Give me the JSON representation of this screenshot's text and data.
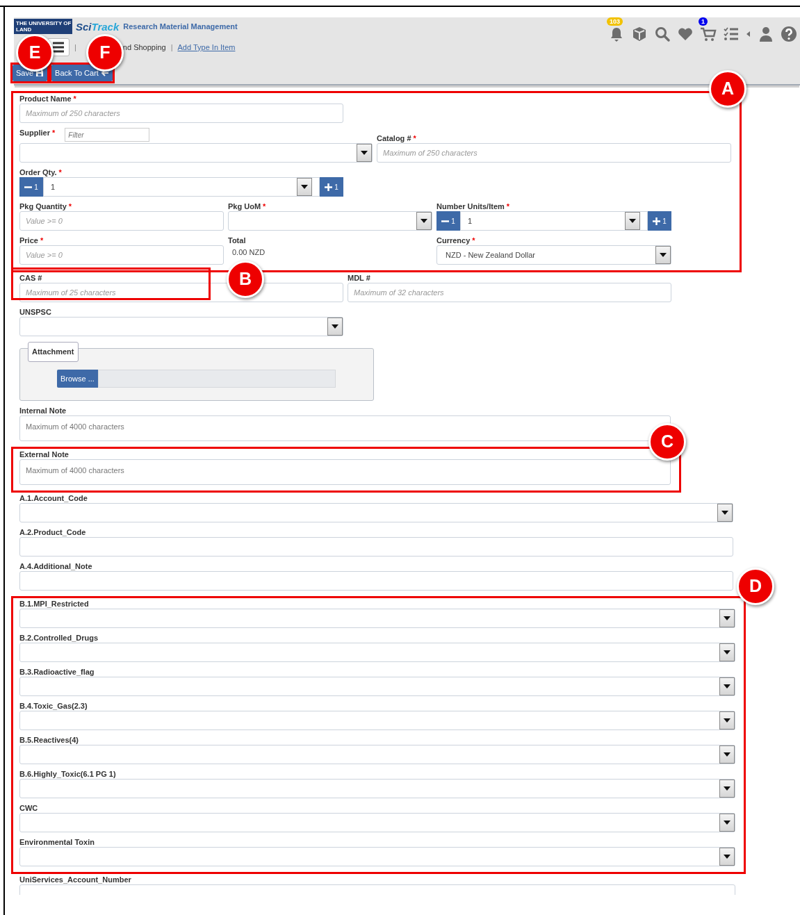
{
  "header": {
    "logo_lines": [
      "THE UNIVERSITY OF",
      "LAND"
    ],
    "app_name_parts": [
      "Sci",
      "Track"
    ],
    "app_subtitle": "Research Material Management",
    "breadcrumb": {
      "separator": "|",
      "items": [
        {
          "label": "nd Shopping",
          "link": false
        },
        {
          "label": "Add Type In Item",
          "link": true
        }
      ]
    },
    "toolbar_icons": [
      {
        "kind": "bell",
        "badge": "103",
        "color": "#f2c200"
      },
      {
        "kind": "box"
      },
      {
        "kind": "search"
      },
      {
        "kind": "heart"
      },
      {
        "kind": "cart",
        "badge": "1",
        "color": "#0000ee"
      },
      {
        "kind": "checklist"
      },
      {
        "kind": "caret"
      },
      {
        "kind": "user"
      },
      {
        "kind": "help"
      }
    ],
    "actions": [
      {
        "label": "Save",
        "callout": "E"
      },
      {
        "label": "Back To Cart",
        "callout": "F"
      }
    ]
  },
  "form": [
    {
      "callout": "A",
      "rows": [
        [
          {
            "kind": "text",
            "label": "Product Name",
            "marker": "*",
            "placeholder": "Maximum of 250 characters"
          }
        ],
        [
          {
            "kind": "select",
            "label": "Supplier",
            "marker": "*",
            "filter_placeholder": "Filter"
          },
          {
            "kind": "text",
            "label": "Catalog #",
            "marker": "*",
            "placeholder": "Maximum of 250 characters"
          }
        ],
        [
          {
            "kind": "spinner",
            "label": "Order Qty.",
            "marker": "*",
            "value": "1",
            "decrement": "1",
            "increment": "1"
          }
        ],
        [
          {
            "kind": "text",
            "label": "Pkg Quantity",
            "marker": "*",
            "placeholder": "Value >= 0"
          },
          {
            "kind": "select",
            "label": "Pkg UoM",
            "marker": "*"
          },
          {
            "kind": "spinner",
            "label": "Number Units/Item",
            "marker": "*",
            "value": "1",
            "decrement": "1",
            "increment": "1"
          }
        ],
        [
          {
            "kind": "text",
            "label": "Price",
            "marker": "*",
            "placeholder": "Value >= 0"
          },
          {
            "kind": "static",
            "label": "Total",
            "value": "0.00 NZD"
          },
          {
            "kind": "select",
            "label": "Currency",
            "marker": "*",
            "value": "NZD - New Zealand Dollar"
          }
        ]
      ]
    },
    {
      "rows": [
        [
          {
            "kind": "text",
            "label": "CAS #",
            "placeholder": "Maximum of 25 characters",
            "callout": "B"
          },
          {
            "kind": "text",
            "label": "MDL #",
            "placeholder": "Maximum of 32 characters"
          }
        ],
        [
          {
            "kind": "select",
            "label": "UNSPSC"
          }
        ],
        [
          {
            "kind": "file",
            "legend": "Attachment",
            "button": "Browse ..."
          }
        ],
        [
          {
            "kind": "textarea",
            "label": "Internal Note",
            "placeholder": "Maximum of 4000 characters"
          }
        ]
      ]
    },
    {
      "callout": "C",
      "rows": [
        [
          {
            "kind": "textarea",
            "label": "External Note",
            "placeholder": "Maximum of 4000 characters"
          }
        ]
      ]
    },
    {
      "rows": [
        [
          {
            "kind": "select",
            "label": "A.1.Account_Code"
          }
        ],
        [
          {
            "kind": "text",
            "label": "A.2.Product_Code"
          }
        ],
        [
          {
            "kind": "text",
            "label": "A.4.Additional_Note"
          }
        ]
      ]
    },
    {
      "callout": "D",
      "rows": [
        [
          {
            "kind": "select",
            "label": "B.1.MPI_Restricted"
          }
        ],
        [
          {
            "kind": "select",
            "label": "B.2.Controlled_Drugs"
          }
        ],
        [
          {
            "kind": "select",
            "label": "B.3.Radioactive_flag"
          }
        ],
        [
          {
            "kind": "select",
            "label": "B.4.Toxic_Gas(2.3)"
          }
        ],
        [
          {
            "kind": "select",
            "label": "B.5.Reactives(4)"
          }
        ],
        [
          {
            "kind": "select",
            "label": "B.6.Highly_Toxic(6.1 PG 1)"
          }
        ],
        [
          {
            "kind": "select",
            "label": "CWC"
          }
        ],
        [
          {
            "kind": "select",
            "label": "Environmental Toxin"
          }
        ]
      ]
    },
    {
      "rows": [
        [
          {
            "kind": "text",
            "label": "UniServices_Account_Number"
          }
        ]
      ]
    }
  ]
}
